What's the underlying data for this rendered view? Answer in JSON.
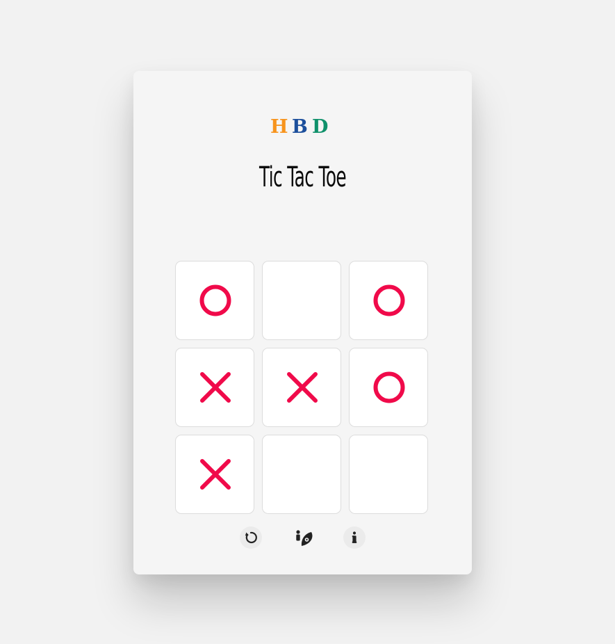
{
  "header": {
    "logo_text": "HBD",
    "title": "Tic Tac Toe"
  },
  "colors": {
    "mark": "#f00a4a",
    "logo_h": "#f7941d",
    "logo_b": "#1c4f9c",
    "logo_d": "#10916b"
  },
  "board": {
    "cells": [
      "O",
      "",
      "O",
      "X",
      "X",
      "O",
      "X",
      "",
      ""
    ]
  },
  "controls": [
    {
      "name": "restart-button",
      "icon": "restart-icon"
    },
    {
      "name": "players-mode-button",
      "icon": "player-vs-computer-icon"
    },
    {
      "name": "info-button",
      "icon": "info-icon"
    }
  ]
}
